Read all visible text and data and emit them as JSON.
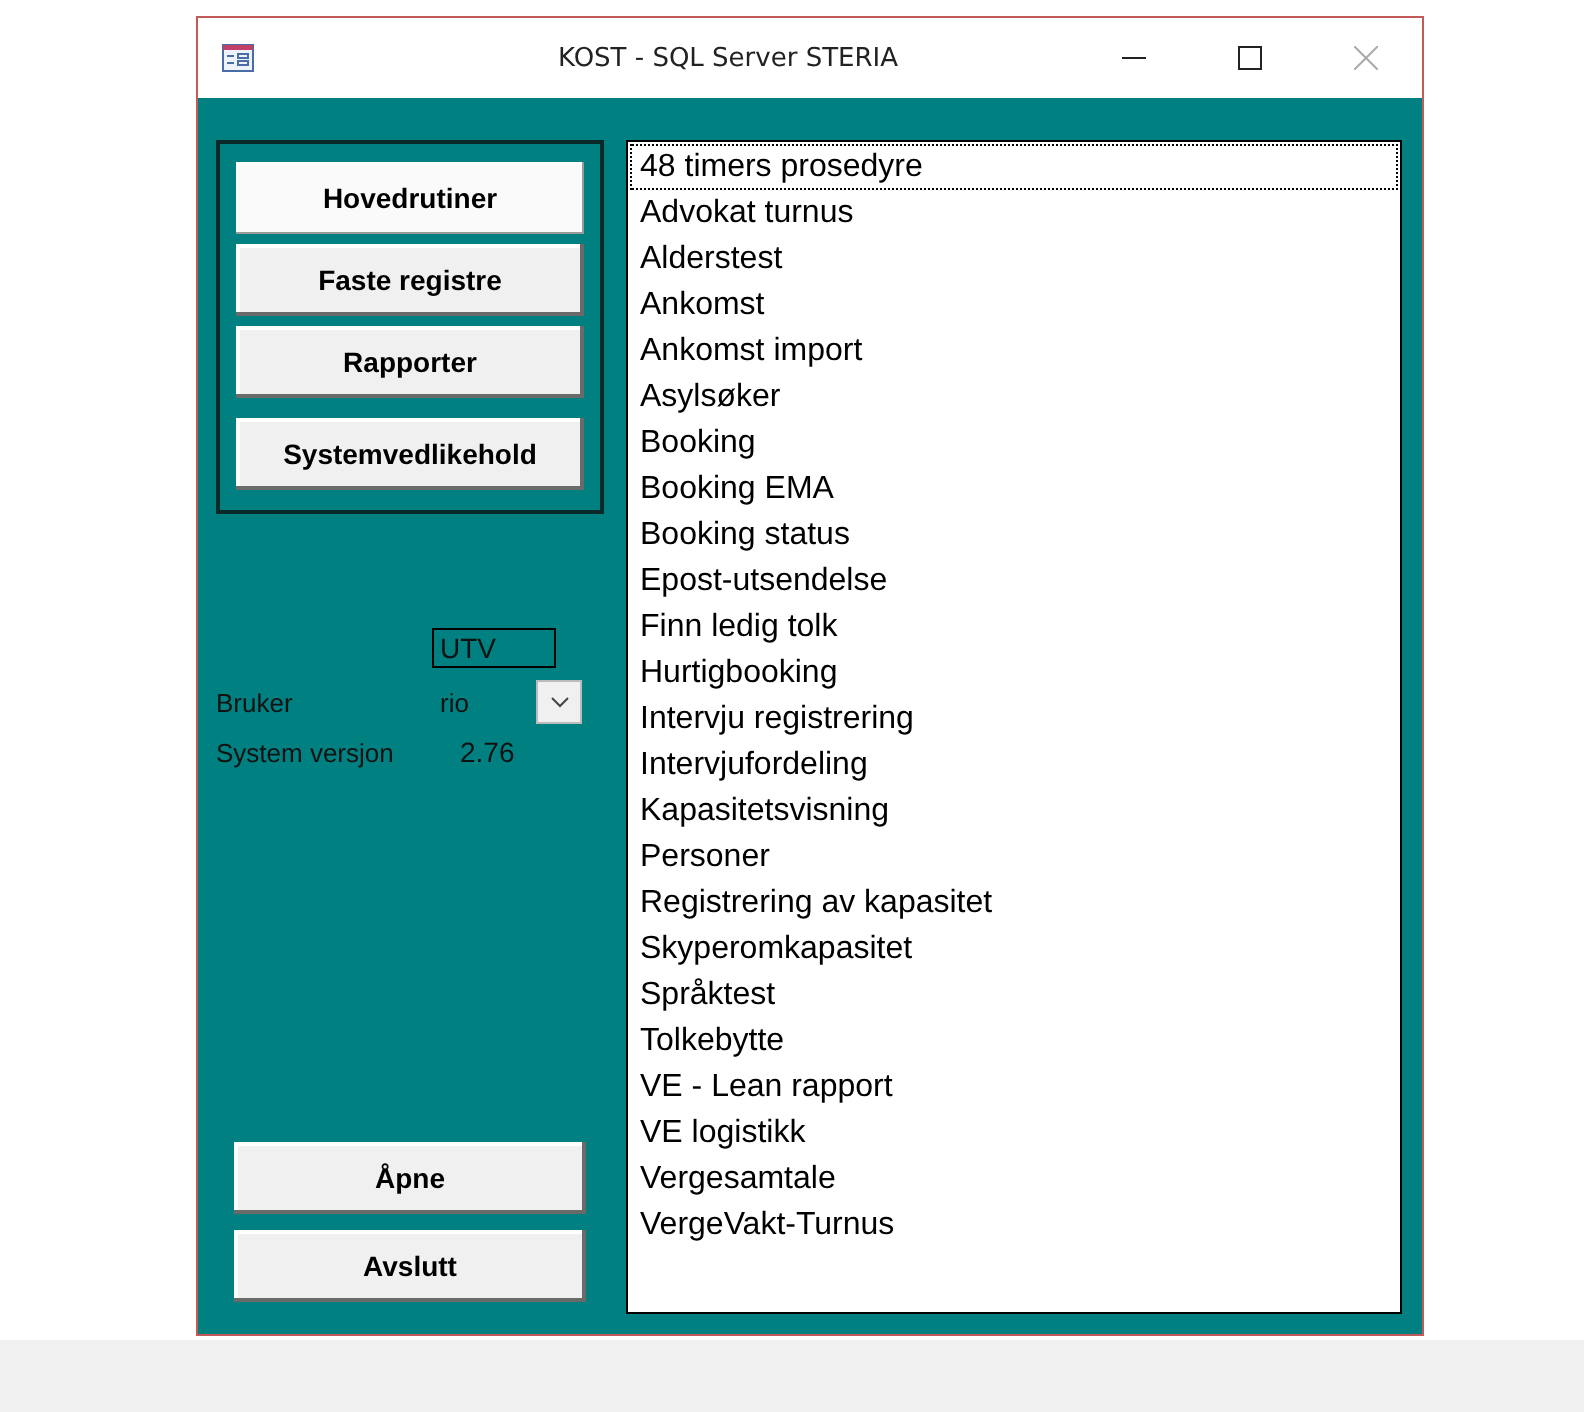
{
  "window": {
    "title": "KOST - SQL Server STERIA"
  },
  "menu_buttons": [
    {
      "label": "Hovedrutiner",
      "selected": true
    },
    {
      "label": "Faste registre",
      "selected": false
    },
    {
      "label": "Rapporter",
      "selected": false
    },
    {
      "label": "Systemvedlikehold",
      "selected": false
    }
  ],
  "environment": "UTV",
  "user": {
    "label": "Bruker",
    "value": "rio"
  },
  "version": {
    "label": "System versjon",
    "value": "2.76"
  },
  "actions": [
    {
      "label": "Åpne"
    },
    {
      "label": "Avslutt"
    }
  ],
  "list": [
    {
      "label": "48 timers prosedyre",
      "selected": true
    },
    {
      "label": "Advokat turnus",
      "selected": false
    },
    {
      "label": "Alderstest",
      "selected": false
    },
    {
      "label": "Ankomst",
      "selected": false
    },
    {
      "label": "Ankomst import",
      "selected": false
    },
    {
      "label": "Asylsøker",
      "selected": false
    },
    {
      "label": "Booking",
      "selected": false
    },
    {
      "label": "Booking EMA",
      "selected": false
    },
    {
      "label": "Booking status",
      "selected": false
    },
    {
      "label": "Epost-utsendelse",
      "selected": false
    },
    {
      "label": "Finn ledig tolk",
      "selected": false
    },
    {
      "label": "Hurtigbooking",
      "selected": false
    },
    {
      "label": "Intervju registrering",
      "selected": false
    },
    {
      "label": "Intervjufordeling",
      "selected": false
    },
    {
      "label": "Kapasitetsvisning",
      "selected": false
    },
    {
      "label": "Personer",
      "selected": false
    },
    {
      "label": "Registrering av kapasitet",
      "selected": false
    },
    {
      "label": "Skyperomkapasitet",
      "selected": false
    },
    {
      "label": "Språktest",
      "selected": false
    },
    {
      "label": "Tolkebytte",
      "selected": false
    },
    {
      "label": "VE - Lean rapport",
      "selected": false
    },
    {
      "label": "VE logistikk",
      "selected": false
    },
    {
      "label": "Vergesamtale",
      "selected": false
    },
    {
      "label": "VergeVakt-Turnus",
      "selected": false
    }
  ]
}
